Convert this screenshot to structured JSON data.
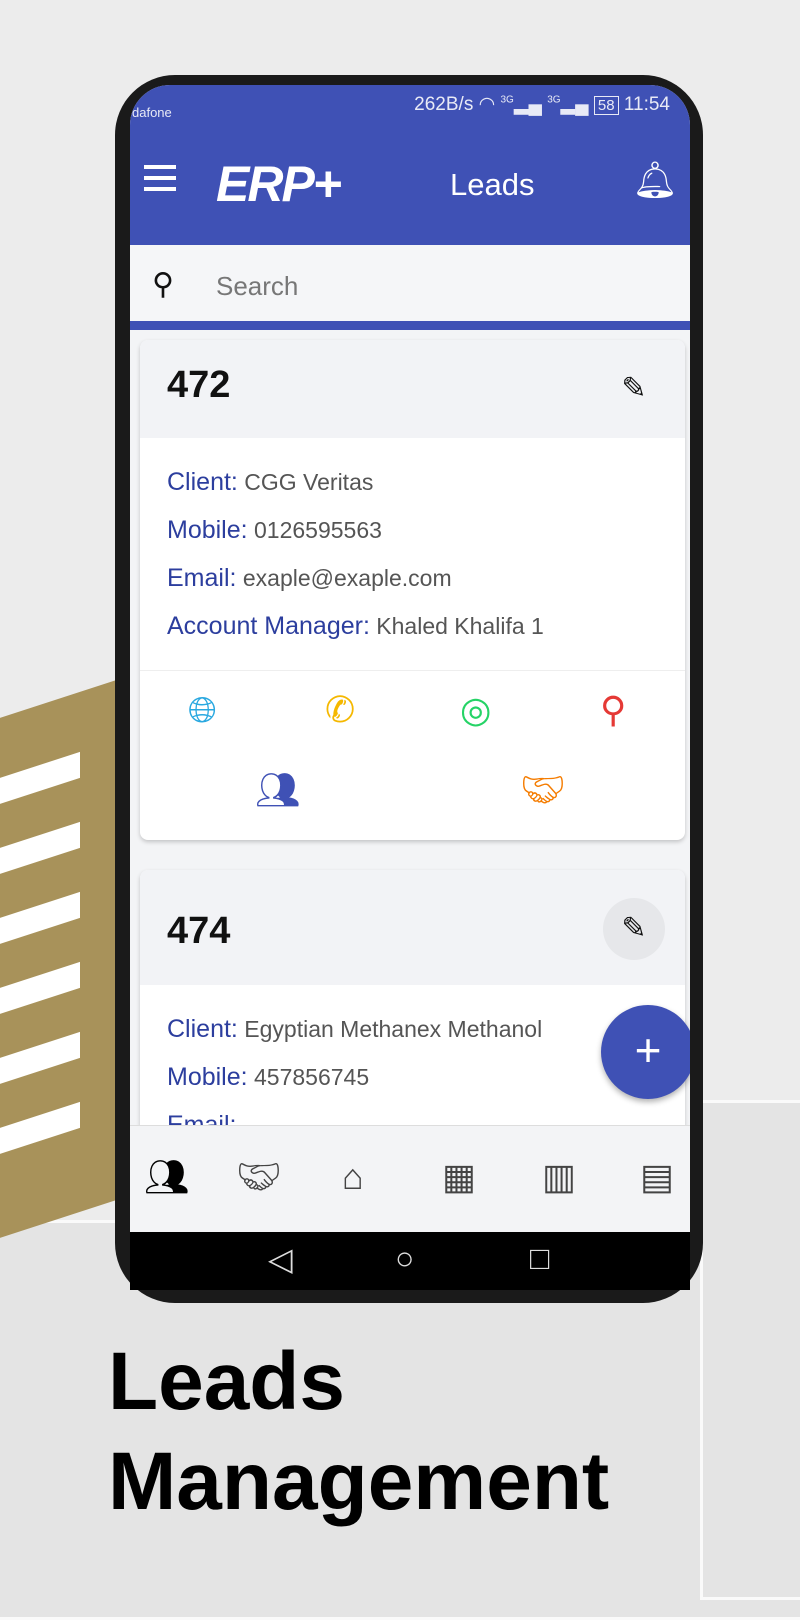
{
  "status_bar": {
    "carrier": "dafone",
    "speed": "262B/s",
    "signal1": "3G",
    "signal2": "3G",
    "battery": "58",
    "time": "11:54"
  },
  "header": {
    "logo": "ERP+",
    "title": "Leads"
  },
  "search": {
    "placeholder": "Search"
  },
  "leads": [
    {
      "id": "472",
      "client_label": "Client:",
      "client": "CGG Veritas",
      "mobile_label": "Mobile:",
      "mobile": "0126595563",
      "email_label": "Email:",
      "email": "exaple@exaple.com",
      "manager_label": "Account Manager:",
      "manager": "Khaled Khalifa 1"
    },
    {
      "id": "474",
      "client_label": "Client:",
      "client": "Egyptian Methanex Methanol",
      "mobile_label": "Mobile:",
      "mobile": "457856745",
      "email_label": "Email:"
    }
  ],
  "bottom_nav": [
    "contacts",
    "deals",
    "home",
    "calendar",
    "companies",
    "reports"
  ],
  "promo": {
    "line1": "Leads",
    "line2": "Management"
  },
  "colors": {
    "primary": "#3f51b5",
    "gold": "#a8925a"
  }
}
